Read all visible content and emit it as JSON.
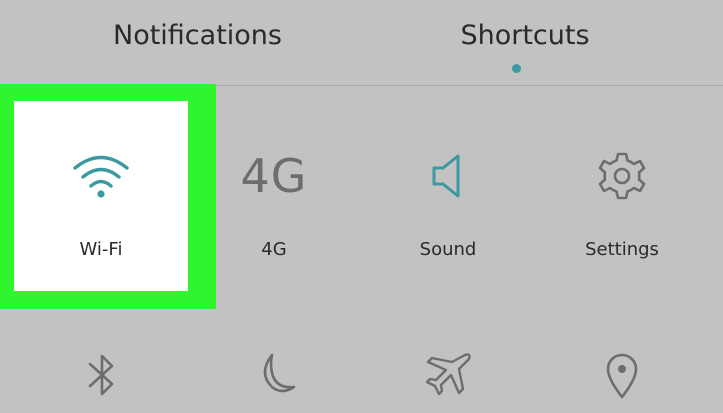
{
  "tabs": [
    {
      "label": "Notifications"
    },
    {
      "label": "Shortcuts",
      "selected": true
    }
  ],
  "colors": {
    "accent": "#3a9aa0",
    "highlight": "#2ef52e",
    "icon_inactive": "#6d6d6d",
    "background": "#c2c2c2"
  },
  "shortcuts": [
    {
      "label": "Wi-Fi",
      "icon": "wifi-icon",
      "active": true
    },
    {
      "label": "4G",
      "icon": "4g-icon",
      "icon_text": "4G"
    },
    {
      "label": "Sound",
      "icon": "speaker-icon"
    },
    {
      "label": "Settings",
      "icon": "gear-icon"
    }
  ],
  "row2_icons": [
    "bluetooth-icon",
    "moon-icon",
    "airplane-icon",
    "location-icon"
  ]
}
